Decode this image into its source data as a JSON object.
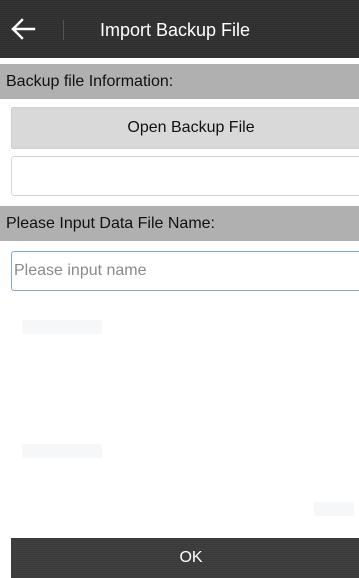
{
  "header": {
    "title": "Import Backup File",
    "back_icon": "arrow-left-icon"
  },
  "backup_section": {
    "heading": "Backup file Information:",
    "open_button_label": "Open Backup File",
    "info_value": ""
  },
  "name_section": {
    "heading": "Please Input Data File Name:",
    "input_placeholder": "Please input name",
    "input_value": ""
  },
  "footer": {
    "ok_label": "OK"
  },
  "colors": {
    "title_bar": "#2f2f2f",
    "section_header": "#b0b0b0",
    "button_bg": "#d9d9d9",
    "input_focus_border": "#86a7c6",
    "ok_bar": "#3a3a3a"
  }
}
